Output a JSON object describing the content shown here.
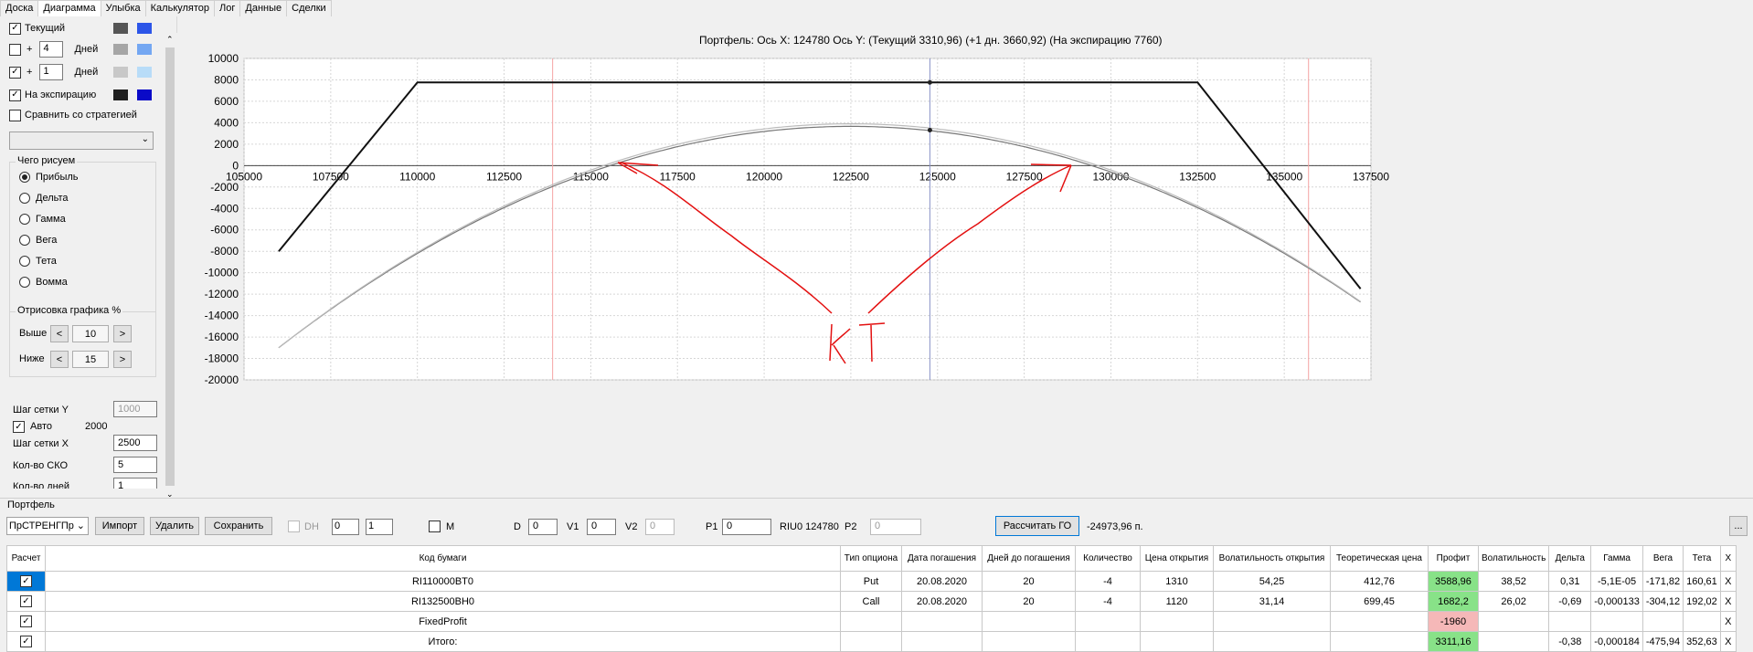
{
  "tabs": [
    "Доска",
    "Диаграмма",
    "Улыбка",
    "Калькулятор",
    "Лог",
    "Данные",
    "Сделки"
  ],
  "left": {
    "current_label": "Текущий",
    "plus": "+",
    "days_label": "Дней",
    "days1": "4",
    "days2": "1",
    "expiration_label": "На экспирацию",
    "compare_label": "Сравнить со стратегией",
    "what_group": "Чего рисуем",
    "radios": [
      "Прибыль",
      "Дельта",
      "Гамма",
      "Вега",
      "Тета",
      "Вомма"
    ],
    "draw_group": "Отрисовка графика %",
    "above_label": "Выше",
    "above_value": "10",
    "below_label": "Ниже",
    "below_value": "15",
    "grid_y_label": "Шаг сетки Y",
    "grid_y_value": "1000",
    "auto_label": "Авто",
    "auto_value": "2000",
    "grid_x_label": "Шаг сетки X",
    "grid_x_value": "2500",
    "sko_label": "Кол-во СКО",
    "sko_value": "5",
    "days_count_label": "Кол-во дней",
    "days_count_value": "1",
    "prev": "<",
    "next": ">",
    "colors": {
      "current": "#555555",
      "current2": "#2c55e8",
      "d4a": "#a6a6a6",
      "d4b": "#74a7f2",
      "d1a": "#c8c8c8",
      "d1b": "#b8dcf8",
      "expa": "#202020",
      "expb": "#0a0ac8"
    }
  },
  "chart": {
    "title": "Портфель: Ось X: 124780 Ось Y:  (Текущий 3310,96)  (+1 дн. 3660,92)  (На экспирацию 7760)",
    "annotation": "КТ"
  },
  "chart_data": {
    "type": "line",
    "xlim": [
      105000,
      137500
    ],
    "ylim": [
      -20000,
      10000
    ],
    "x_ticks": [
      105000,
      107500,
      110000,
      112500,
      115000,
      117500,
      120000,
      122500,
      125000,
      127500,
      130000,
      132500,
      135000,
      137500
    ],
    "y_ticks": [
      10000,
      8000,
      6000,
      4000,
      2000,
      0,
      -2000,
      -4000,
      -6000,
      -8000,
      -10000,
      -12000,
      -14000,
      -16000,
      -18000,
      -20000
    ],
    "x_cursor": 124780,
    "red_lines": [
      113900,
      135700
    ],
    "series": [
      {
        "color": "#111111",
        "x": [
          106000,
          110000,
          132500,
          137200
        ],
        "y": [
          -8000,
          7760,
          7760,
          -11500
        ]
      },
      {
        "color": "#777777",
        "curve": "parabola",
        "vertex_x": 122500,
        "vertex_y": 3660,
        "x": [
          106000,
          137200
        ],
        "y_ends": [
          -17000,
          -17000
        ]
      },
      {
        "color": "#bbbbbb",
        "curve": "parabola",
        "vertex_x": 122500,
        "vertex_y": 3900,
        "x": [
          106000,
          137200
        ],
        "y_ends": [
          -17000,
          -17000
        ]
      }
    ],
    "points": [
      {
        "x": 124780,
        "y": 7760
      },
      {
        "x": 124780,
        "y": 3310
      }
    ]
  },
  "portfolio": {
    "title": "Портфель",
    "strategy": "ПрСТРЕНГПр",
    "import": "Импорт",
    "delete": "Удалить",
    "save": "Сохранить",
    "dh": "DH",
    "spin1": "0",
    "spin2": "1",
    "m": "M",
    "d_label": "D",
    "d_val": "0",
    "v1_label": "V1",
    "v1_val": "0",
    "v2_label": "V2",
    "v2_val": "0",
    "p1_label": "P1",
    "p1_val": "0",
    "riu": "RIU0 124780",
    "p2_label": "P2",
    "p2_val": "0",
    "calc_go": "Рассчитать ГО",
    "go_value": "-24973,96 п.",
    "dots": "..."
  },
  "table": {
    "headers": [
      "Расчет",
      "Код бумаги",
      "Тип опциона",
      "Дата погашения",
      "Дней до погашения",
      "Количество",
      "Цена открытия",
      "Волатильность открытия",
      "Теоретическая цена",
      "Профит",
      "Волатильность",
      "Дельта",
      "Гамма",
      "Вега",
      "Тета",
      "X"
    ],
    "rows": [
      [
        "",
        "RI110000BT0",
        "Put",
        "20.08.2020",
        "20",
        "-4",
        "1310",
        "54,25",
        "412,76",
        "3588,96",
        "38,52",
        "0,31",
        "-5,1E-05",
        "-171,82",
        "160,61",
        "X"
      ],
      [
        "",
        "RI132500BH0",
        "Call",
        "20.08.2020",
        "20",
        "-4",
        "1120",
        "31,14",
        "699,45",
        "1682,2",
        "26,02",
        "-0,69",
        "-0,000133",
        "-304,12",
        "192,02",
        "X"
      ],
      [
        "",
        "FixedProfit",
        "",
        "",
        "",
        "",
        "",
        "",
        "",
        "-1960",
        "",
        "",
        "",
        "",
        "",
        "X"
      ],
      [
        "",
        "Итого:",
        "",
        "",
        "",
        "",
        "",
        "",
        "",
        "3311,16",
        "",
        "-0,38",
        "-0,000184",
        "-475,94",
        "352,63",
        "X"
      ]
    ]
  }
}
